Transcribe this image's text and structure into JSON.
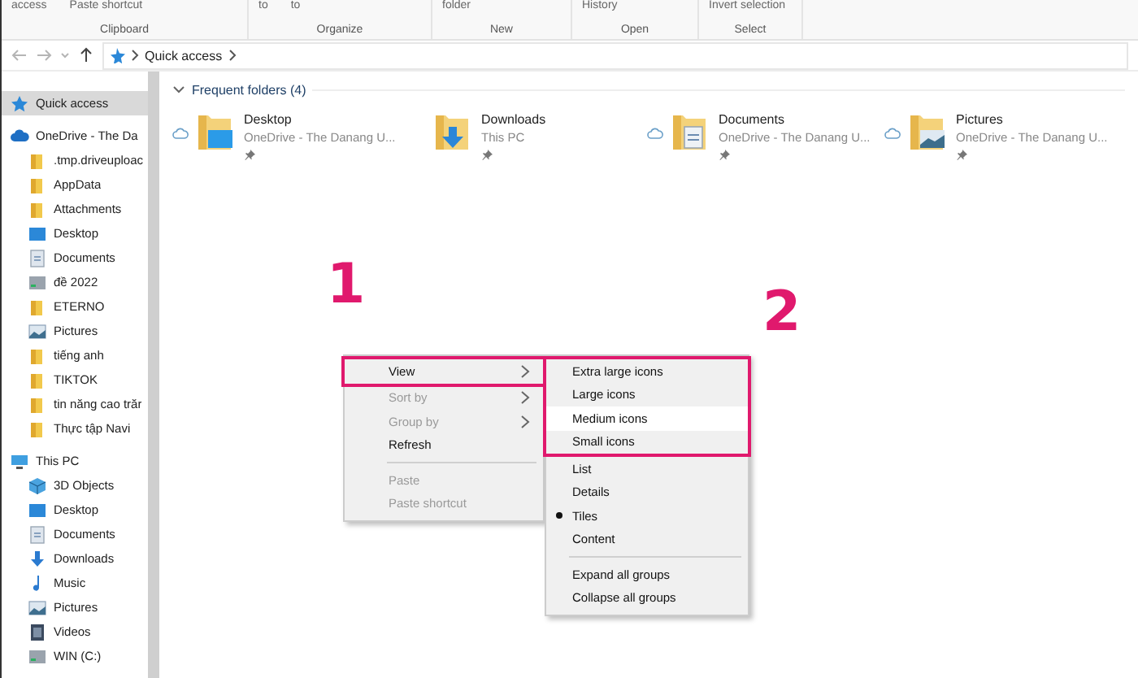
{
  "ribbon": {
    "groups": [
      {
        "label": "Clipboard",
        "commands": [
          "access",
          "Paste shortcut"
        ]
      },
      {
        "label": "Organize",
        "commands": [
          "to",
          "to"
        ]
      },
      {
        "label": "New",
        "commands": [
          "folder"
        ]
      },
      {
        "label": "Open",
        "commands": [
          "History"
        ]
      },
      {
        "label": "Select",
        "commands": [
          "Invert selection"
        ]
      }
    ]
  },
  "address_bar": {
    "path": [
      "Quick access"
    ]
  },
  "sidebar": {
    "items": [
      {
        "label": "Quick access",
        "kind": "quick",
        "selected": true
      },
      {
        "label": "OneDrive - The Da",
        "kind": "cloud",
        "selected": false,
        "children": [
          {
            "label": ".tmp.driveuploac",
            "kind": "folder",
            "selected": false
          },
          {
            "label": "AppData",
            "kind": "folder",
            "selected": false
          },
          {
            "label": "Attachments",
            "kind": "folder",
            "selected": false
          },
          {
            "label": "Desktop",
            "kind": "desktop",
            "selected": false
          },
          {
            "label": "Documents",
            "kind": "documents",
            "selected": false
          },
          {
            "label": "đề 2022",
            "kind": "drive",
            "selected": false
          },
          {
            "label": "ETERNO",
            "kind": "folder",
            "selected": false
          },
          {
            "label": "Pictures",
            "kind": "pictures",
            "selected": false
          },
          {
            "label": "tiếng anh",
            "kind": "folder",
            "selected": false
          },
          {
            "label": "TIKTOK",
            "kind": "folder",
            "selected": false
          },
          {
            "label": "tin năng cao trăr",
            "kind": "folder",
            "selected": false
          },
          {
            "label": "Thực tập Navi",
            "kind": "folder",
            "selected": false
          }
        ]
      },
      {
        "label": "This PC",
        "kind": "pc",
        "selected": false,
        "children": [
          {
            "label": "3D Objects",
            "kind": "objects",
            "selected": false
          },
          {
            "label": "Desktop",
            "kind": "desktop",
            "selected": false
          },
          {
            "label": "Documents",
            "kind": "documents",
            "selected": false
          },
          {
            "label": "Downloads",
            "kind": "downloads",
            "selected": false
          },
          {
            "label": "Music",
            "kind": "music",
            "selected": false
          },
          {
            "label": "Pictures",
            "kind": "pictures",
            "selected": false
          },
          {
            "label": "Videos",
            "kind": "videos",
            "selected": false
          },
          {
            "label": "WIN (C:)",
            "kind": "drive",
            "selected": false
          }
        ]
      }
    ]
  },
  "frequent_folders": {
    "heading": "Frequent folders (4)",
    "expanded": true,
    "items": [
      {
        "name": "Desktop",
        "location": "OneDrive - The Danang U...",
        "kind": "desktop",
        "cloud": true,
        "pinned": true
      },
      {
        "name": "Downloads",
        "location": "This PC",
        "kind": "downloads",
        "cloud": false,
        "pinned": true
      },
      {
        "name": "Documents",
        "location": "OneDrive - The Danang U...",
        "kind": "documents",
        "cloud": true,
        "pinned": true
      },
      {
        "name": "Pictures",
        "location": "OneDrive - The Danang U...",
        "kind": "pictures",
        "cloud": true,
        "pinned": true
      }
    ]
  },
  "context_menu": {
    "items": [
      {
        "kind": "item",
        "label": "View",
        "submenu": true,
        "disabled": false,
        "framed": true
      },
      {
        "kind": "item",
        "label": "Sort by",
        "submenu": true,
        "disabled": true,
        "framed": false
      },
      {
        "kind": "item",
        "label": "Group by",
        "submenu": true,
        "disabled": true,
        "framed": false
      },
      {
        "kind": "item",
        "label": "Refresh",
        "submenu": false,
        "disabled": false,
        "framed": false
      },
      {
        "kind": "separator"
      },
      {
        "kind": "item",
        "label": "Paste",
        "submenu": false,
        "disabled": true,
        "framed": false
      },
      {
        "kind": "item",
        "label": "Paste shortcut",
        "submenu": false,
        "disabled": true,
        "framed": false
      }
    ]
  },
  "view_submenu": {
    "items": [
      {
        "kind": "item",
        "label": "Extra large icons",
        "selected": false,
        "checked": false,
        "framed": true
      },
      {
        "kind": "item",
        "label": "Large icons",
        "selected": false,
        "checked": false,
        "framed": true
      },
      {
        "kind": "item",
        "label": "Medium icons",
        "selected": true,
        "checked": false,
        "framed": true
      },
      {
        "kind": "item",
        "label": "Small icons",
        "selected": false,
        "checked": false,
        "framed": true
      },
      {
        "kind": "item",
        "label": "List",
        "selected": false,
        "checked": false,
        "framed": false
      },
      {
        "kind": "item",
        "label": "Details",
        "selected": false,
        "checked": false,
        "framed": false
      },
      {
        "kind": "item",
        "label": "Tiles",
        "selected": false,
        "checked": true,
        "framed": false
      },
      {
        "kind": "item",
        "label": "Content",
        "selected": false,
        "checked": false,
        "framed": false
      },
      {
        "kind": "separator"
      },
      {
        "kind": "item",
        "label": "Expand all groups",
        "selected": false,
        "checked": false,
        "framed": false
      },
      {
        "kind": "item",
        "label": "Collapse all groups",
        "selected": false,
        "checked": false,
        "framed": false
      }
    ]
  },
  "annotations": [
    {
      "label": "1"
    },
    {
      "label": "2"
    }
  ]
}
